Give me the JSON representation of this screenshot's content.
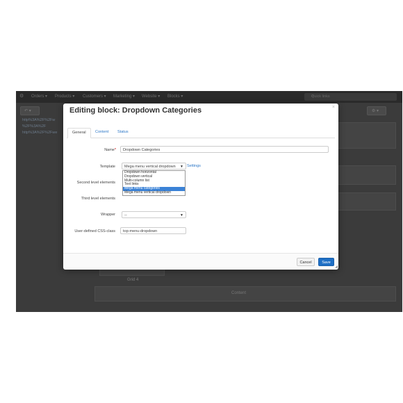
{
  "topbar": {
    "menu": [
      "Orders ▾",
      "Products ▾",
      "Customers ▾",
      "Marketing ▾",
      "Website ▾",
      "Blocks ▾"
    ],
    "search_placeholder": "Quick links"
  },
  "background": {
    "links": [
      "http%3A%2F%2Fw",
      "%2F%3A%2F",
      "http%3A%2F%2Fwe"
    ],
    "content_label": "Content",
    "block_label": "Grid 4"
  },
  "modal": {
    "title": "Editing block: Dropdown Categories",
    "close": "×",
    "tabs": [
      "General",
      "Content",
      "Status"
    ],
    "fields": {
      "name_label": "Name",
      "required_mark": "*",
      "name_value": "Dropdown Categories",
      "template_label": "Template",
      "template_value": "Mega menu vertical dropdown",
      "settings_link": "Settings",
      "second_level_label": "Second level elements",
      "third_level_label": "Third level elements",
      "wrapper_label": "Wrapper",
      "wrapper_value": "--",
      "css_label": "User-defined CSS-class",
      "css_value": "top-menu-dropdown"
    },
    "template_options": [
      "Dropdown horizontal",
      "Dropdown vertical",
      "Multi-column list",
      "Text links",
      "Mega menu categories",
      "Mega menu vertical dropdown"
    ],
    "selected_option": "Mega menu categories",
    "buttons": {
      "cancel": "Cancel",
      "save": "Save"
    }
  },
  "colors": {
    "accent": "#2c77c7",
    "save": "#1e6fc5",
    "highlight": "#3b82d6",
    "overlay": "#3b3b3b"
  }
}
